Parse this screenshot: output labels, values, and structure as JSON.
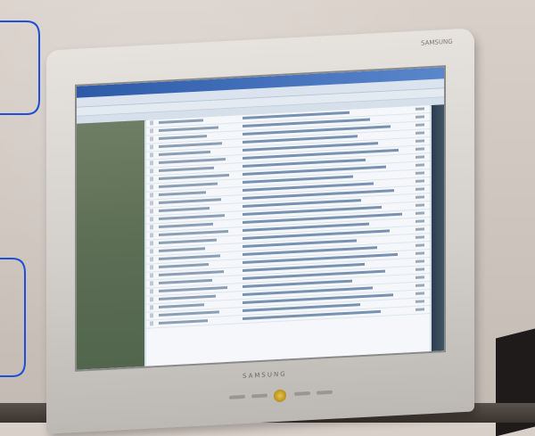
{
  "photo": {
    "subject": "",
    "monitor": {
      "brand_top": "SAMSUNG",
      "brand_bottom": "SAMSUNG"
    },
    "screen": {
      "window_title": "",
      "message_rows": 26
    }
  },
  "colors": {
    "annotation_outline": "#1e4fd6",
    "titlebar": "#2d5aa8",
    "folder_pane": "#5c6e55",
    "power_button": "#d4ad2e"
  }
}
